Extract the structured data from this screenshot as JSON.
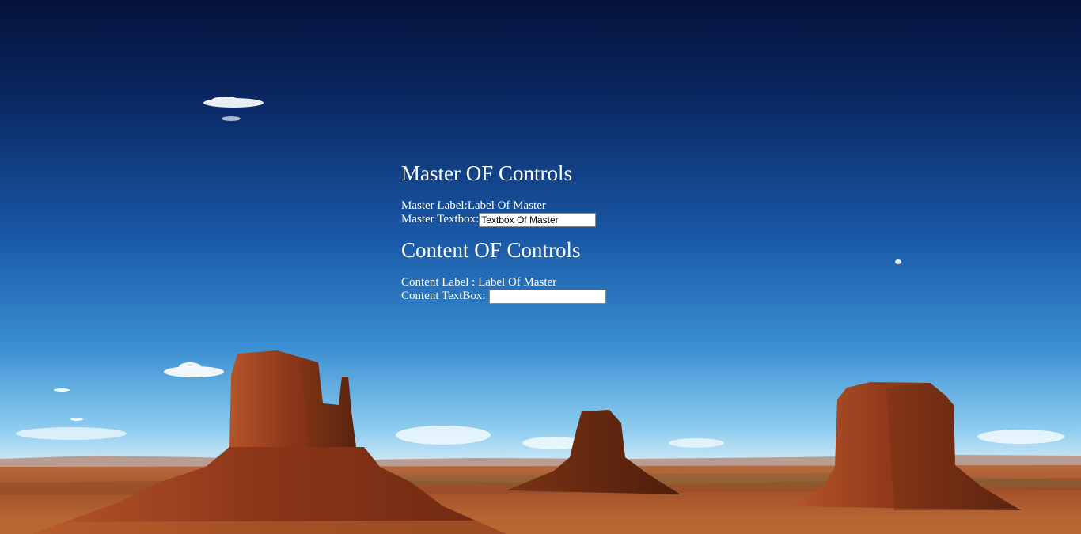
{
  "master": {
    "heading": "Master OF Controls",
    "label_caption": "Master Label:",
    "label_value": "Label Of Master",
    "textbox_caption": "Master Textbox:",
    "textbox_value": "Textbox Of Master"
  },
  "content": {
    "heading": "Content OF Controls",
    "label_caption": "Content Label : ",
    "label_value": "Label Of Master",
    "textbox_caption": "Content TextBox:",
    "textbox_value": ""
  },
  "background": {
    "image_icon": "desert-monument-valley-image",
    "sky_top_color": "#05123a",
    "sky_mid_color": "#1a5aa8",
    "sky_horizon_color": "#bfe3f5",
    "rock_color": "#9a3f1c",
    "ground_color": "#a5532a"
  }
}
